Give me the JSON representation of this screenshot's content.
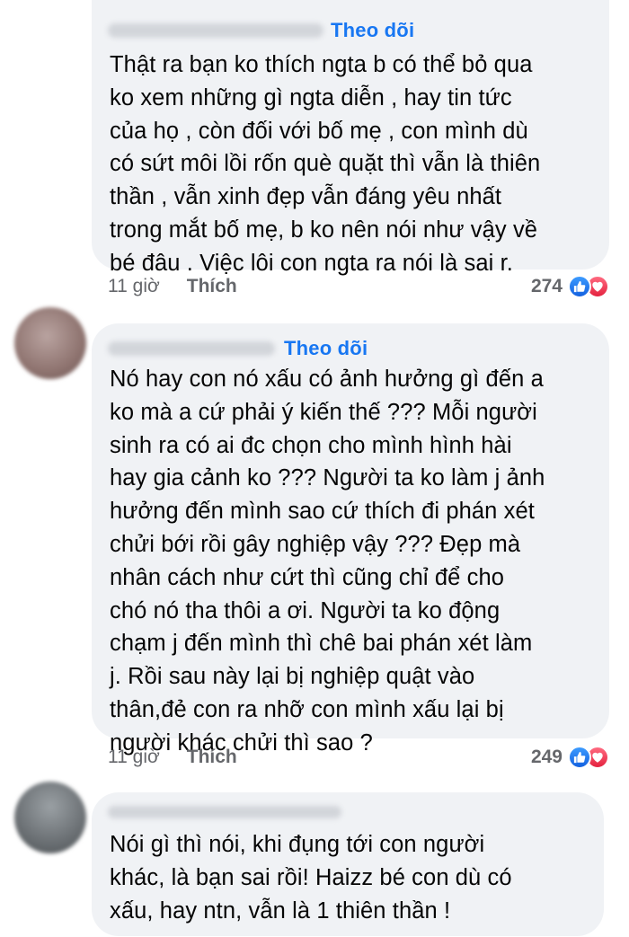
{
  "comments": [
    {
      "follow_label": "Theo dõi",
      "text": "Thật ra bạn ko thích ngta b có thể bỏ qua\nko xem những gì ngta diễn , hay tin tức\ncủa họ , còn đối với bố mẹ , con mình dù\ncó sứt môi lồi rốn què quặt thì vẫn là thiên\nthần , vẫn xinh đẹp vẫn đáng yêu nhất\ntrong mắt bố mẹ, b ko nên nói như vậy về\nbé đâu . Việc lôi con ngta ra nói là sai r.",
      "time": "11 giờ",
      "like_label": "Thích",
      "reaction_count": "274",
      "reaction_icons": [
        "like-icon",
        "love-icon"
      ]
    },
    {
      "follow_label": "Theo dõi",
      "text": "Nó hay con nó xấu có ảnh hưởng gì đến a\nko mà a cứ phải ý kiến thế ??? Mỗi người\nsinh ra có ai đc chọn cho mình hình hài\nhay gia cảnh ko ??? Người ta ko làm j ảnh\nhưởng đến mình sao cứ thích đi phán xét\nchửi bới rồi gây nghiệp vậy ??? Đẹp mà\nnhân cách như cứt thì cũng chỉ để cho\nchó nó tha thôi a ơi. Người ta ko động\nchạm j đến mình thì chê bai phán xét làm\nj. Rồi sau này lại bị nghiệp quật vào\nthân,đẻ con ra nhỡ con mình xấu lại bị\nngười khác chửi thì sao ?",
      "time": "11 giờ",
      "like_label": "Thích",
      "reaction_count": "249",
      "reaction_icons": [
        "like-icon",
        "love-icon"
      ]
    },
    {
      "text": "Nói gì thì nói, khi đụng tới con người\nkhác, là bạn sai rồi! Haizz bé con dù có\nxấu, hay ntn, vẫn là 1 thiên thần !"
    }
  ],
  "colors": {
    "bubble": "#f0f2f5",
    "follow": "#1877f2",
    "meta": "#65676b",
    "text": "#050505"
  }
}
